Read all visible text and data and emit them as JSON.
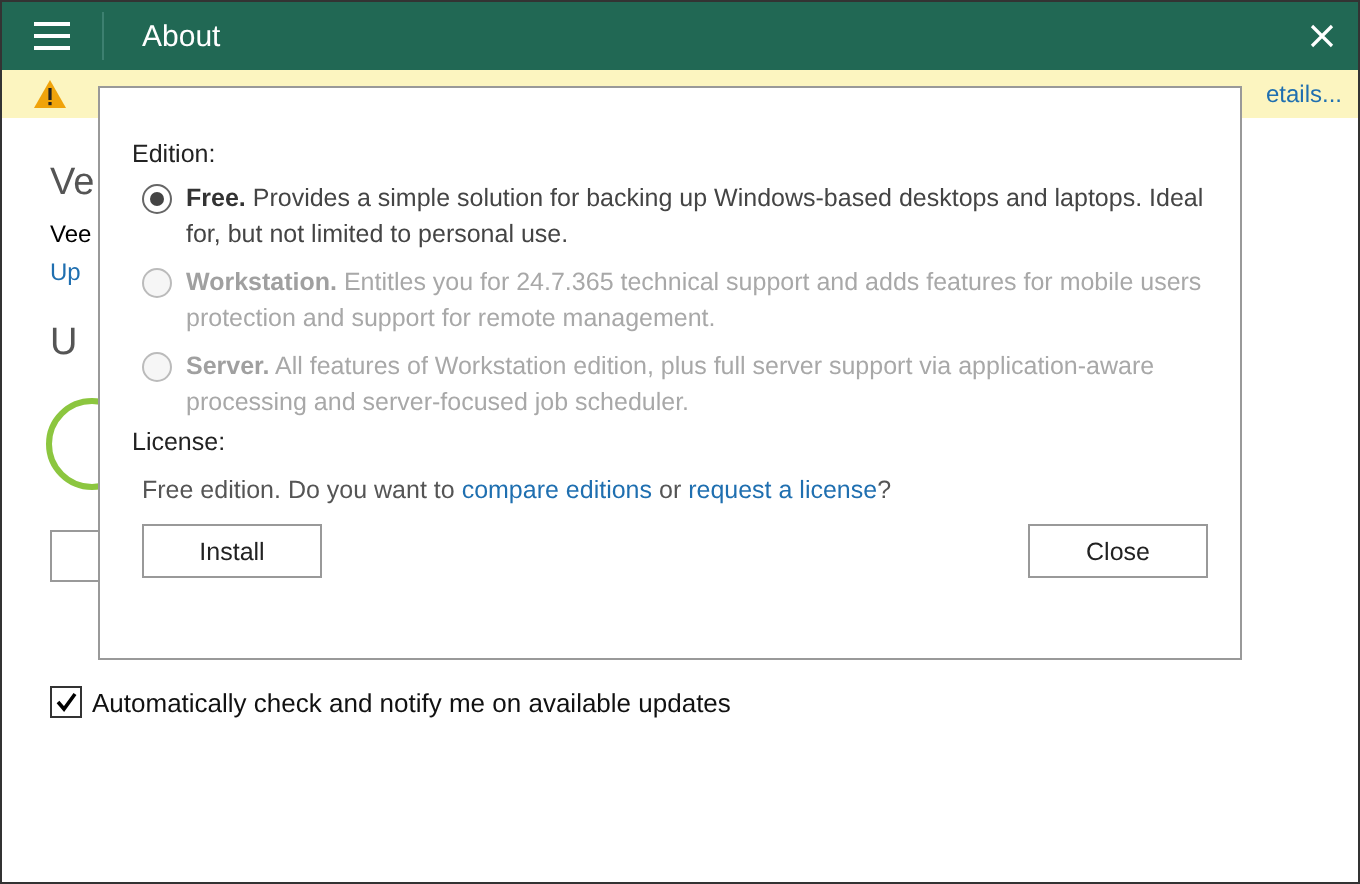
{
  "window": {
    "title": "About"
  },
  "warning": {
    "link": "etails..."
  },
  "background": {
    "heading_1": "Ve",
    "text_1": "Vee",
    "link_1": "Up",
    "heading_2": "U",
    "auto_update": {
      "label": "Automatically check and notify me on available updates",
      "checked": true
    }
  },
  "dialog": {
    "edition_label": "Edition:",
    "editions": [
      {
        "name": "Free.",
        "description": "Provides a simple solution for backing up Windows-based desktops and laptops. Ideal for, but not limited to personal use.",
        "selected": true,
        "disabled": false
      },
      {
        "name": "Workstation.",
        "description": "Entitles you for 24.7.365 technical support and adds features for mobile users protection and support for remote management.",
        "selected": false,
        "disabled": true
      },
      {
        "name": "Server.",
        "description": "All features of Workstation edition, plus full server support via application-aware processing and server-focused job scheduler.",
        "selected": false,
        "disabled": true
      }
    ],
    "license_label": "License:",
    "license_text": {
      "before": "Free edition. Do you want to",
      "link_1": "compare editions",
      "middle": "or",
      "link_2": "request a license",
      "after": "?"
    },
    "buttons": [
      "Install",
      "Close"
    ]
  }
}
